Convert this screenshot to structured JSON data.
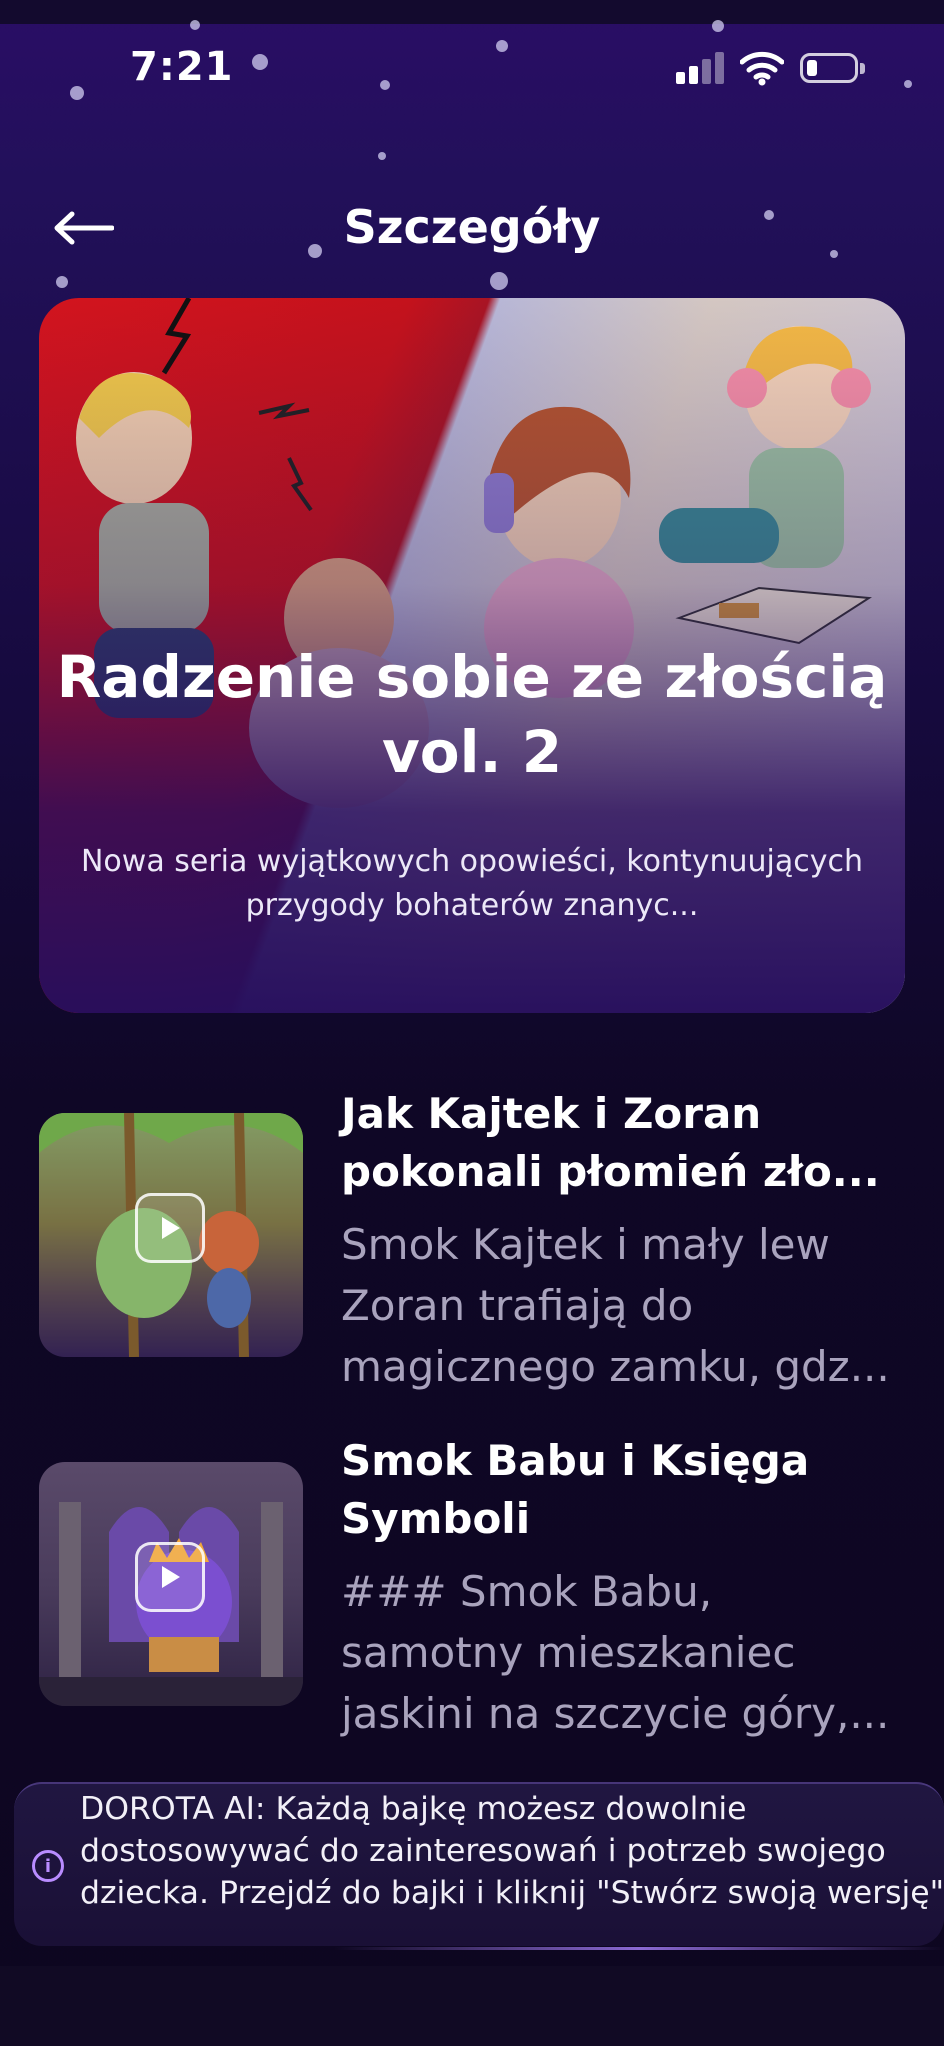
{
  "status_bar": {
    "time": "7:21"
  },
  "header": {
    "title": "Szczegóły",
    "back_icon": "arrow-left-icon"
  },
  "hero": {
    "title": "Radzenie sobie ze złością vol. 2",
    "description": "Nowa seria wyjątkowych opowieści, kontynuujących przygody bohaterów znanyc..."
  },
  "stories": [
    {
      "title": "Jak Kajtek i Zoran pokonali płomień zło...",
      "description": "Smok Kajtek i mały lew Zoran trafiają do magicznego zamku, gdz..."
    },
    {
      "title": "Smok Babu i Księga Symboli",
      "description": "### Smok Babu, samotny mieszkaniec jaskini na szczycie góry,..."
    }
  ],
  "banner": {
    "text": "DOROTA AI: Każdą bajkę możesz dowolnie dostosowywać do zainteresowań i potrzeb swojego dziecka. Przejdź do bajki i kliknij \"Stwórz swoją wersję\""
  },
  "colors": {
    "accent": "#b98cff",
    "background": "#160a3e"
  }
}
